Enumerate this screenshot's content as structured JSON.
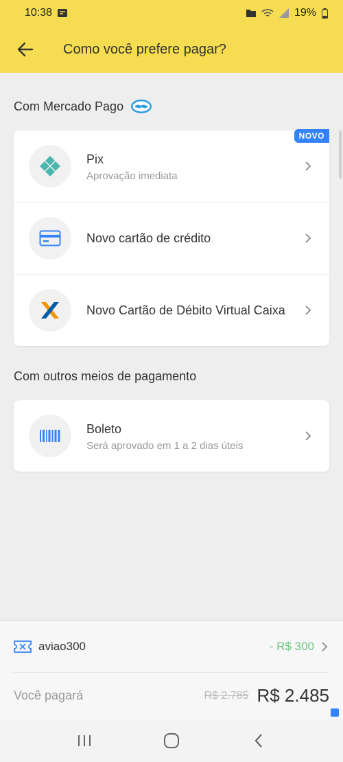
{
  "status_bar": {
    "time": "10:38",
    "battery": "19%"
  },
  "header": {
    "title": "Como você prefere pagar?"
  },
  "sections": [
    {
      "title": "Com Mercado Pago",
      "items": [
        {
          "title": "Pix",
          "subtitle": "Aprovação imediata",
          "badge": "NOVO",
          "icon": "pix-icon"
        },
        {
          "title": "Novo cartão de crédito",
          "subtitle": "",
          "icon": "credit-card-icon"
        },
        {
          "title": "Novo Cartão de Débito Virtual Caixa",
          "subtitle": "",
          "icon": "caixa-icon"
        }
      ]
    },
    {
      "title": "Com outros meios de pagamento",
      "items": [
        {
          "title": "Boleto",
          "subtitle": "Será aprovado em 1 a 2 dias úteis",
          "icon": "barcode-icon"
        }
      ]
    }
  ],
  "coupon": {
    "code": "aviao300",
    "value": "- R$ 300"
  },
  "payment": {
    "label": "Você pagará",
    "old_price": "R$ 2.785",
    "new_price": "R$ 2.485"
  },
  "colors": {
    "header": "#f5dc50",
    "accent": "#3483fa",
    "discount": "#6cc57e"
  }
}
